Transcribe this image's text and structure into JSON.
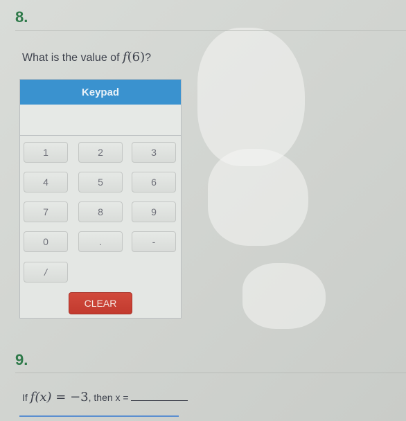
{
  "question8": {
    "number": "8.",
    "prompt_prefix": "What is the value of ",
    "prompt_func": "f",
    "prompt_arg": "(6)",
    "prompt_suffix": "?"
  },
  "keypad": {
    "title": "Keypad",
    "display_value": "",
    "keys": [
      "1",
      "2",
      "3",
      "4",
      "5",
      "6",
      "7",
      "8",
      "9",
      "0",
      ".",
      "-",
      "/"
    ],
    "clear_label": "CLEAR",
    "colors": {
      "header": "#3a92cf",
      "clear": "#c9402f"
    }
  },
  "question9": {
    "number": "9.",
    "prompt_if": "If ",
    "prompt_func": "f",
    "prompt_x": "(x)",
    "prompt_equals": " = −3",
    "prompt_rest": ", then x = ",
    "answer_value": ""
  }
}
